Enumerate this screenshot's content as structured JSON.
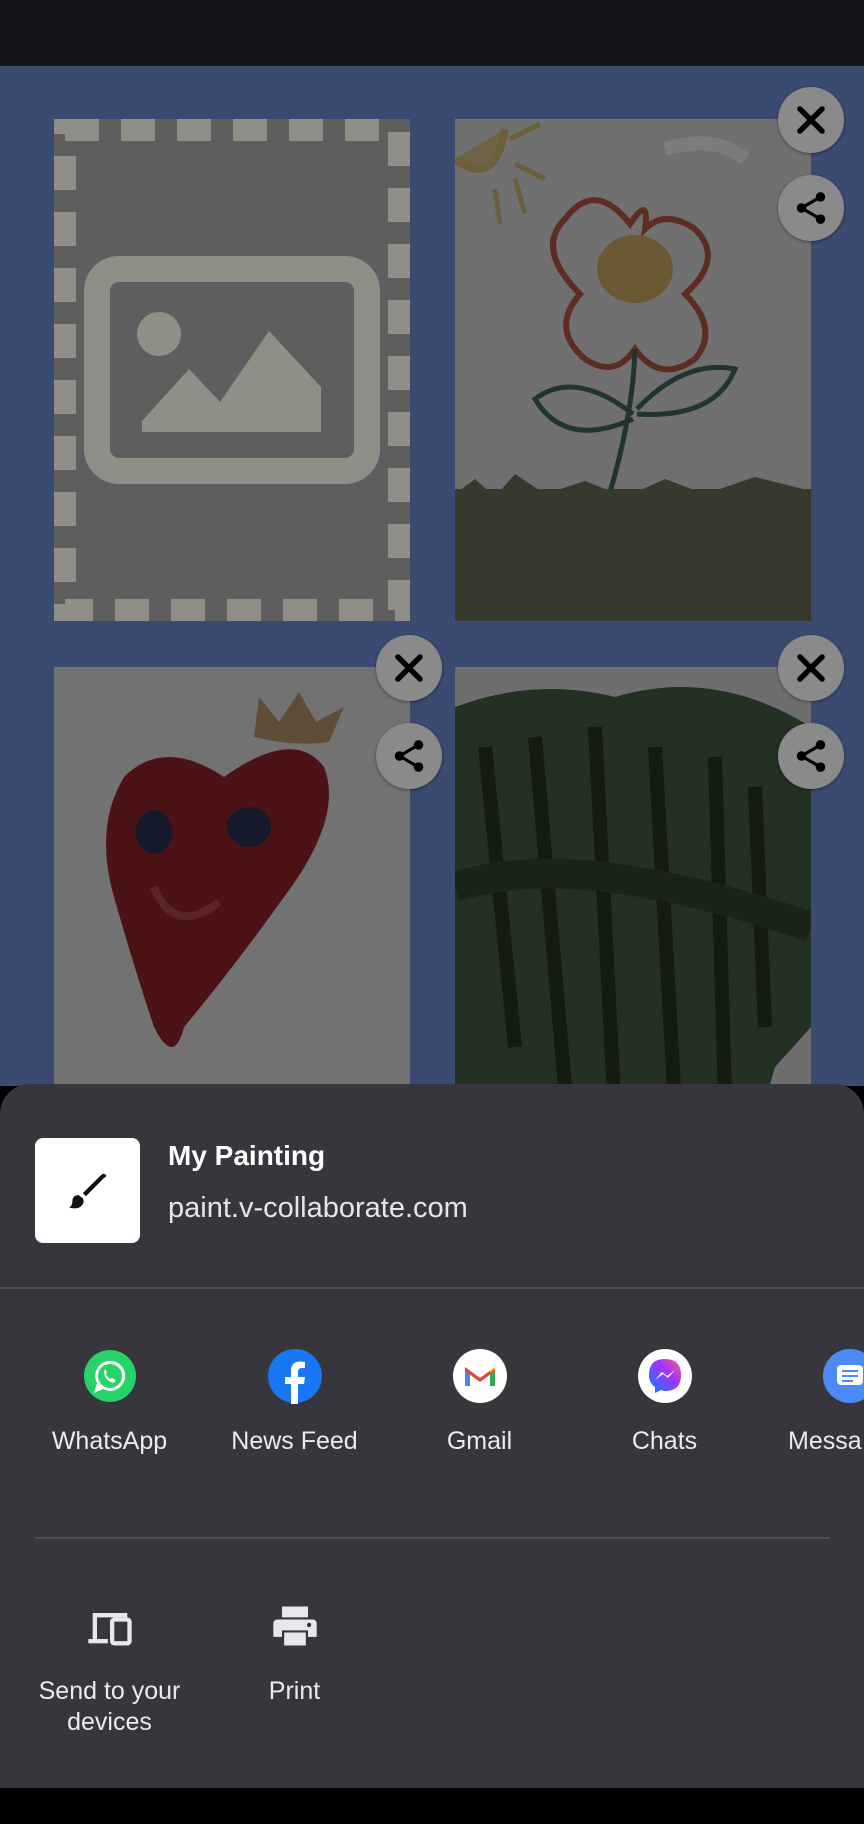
{
  "share_sheet": {
    "title": "My Painting",
    "subtitle": "paint.v-collaborate.com",
    "targets": [
      {
        "label": "WhatsApp",
        "icon": "whatsapp-icon",
        "color": "#25d366"
      },
      {
        "label": "News Feed",
        "icon": "facebook-icon",
        "color": "#1877f2"
      },
      {
        "label": "Gmail",
        "icon": "gmail-icon",
        "color": "#ffffff"
      },
      {
        "label": "Chats",
        "icon": "messenger-icon",
        "color": "#ffffff"
      },
      {
        "label": "Messa",
        "icon": "messages-icon",
        "color": "#4c8bf5"
      }
    ],
    "actions": [
      {
        "label": "Send to your devices",
        "icon": "devices-icon"
      },
      {
        "label": "Print",
        "icon": "print-icon"
      }
    ]
  },
  "colors": {
    "gallery_bg": "#3a4a70",
    "sheet_bg": "#36363c",
    "scrim_button": "#8a8a8a"
  }
}
